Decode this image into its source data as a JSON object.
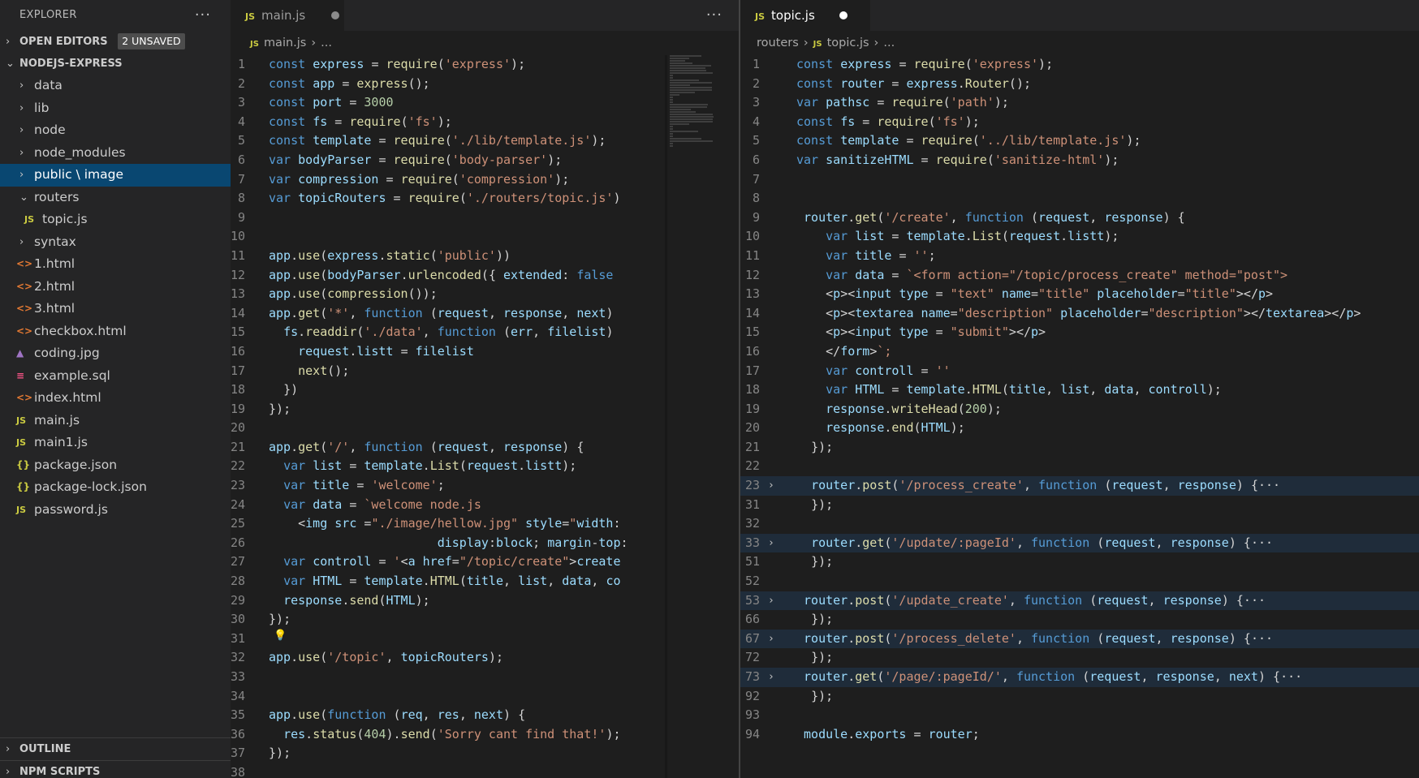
{
  "sidebar": {
    "title": "EXPLORER",
    "more": "···",
    "open_editors": {
      "label": "OPEN EDITORS",
      "badge": "2 UNSAVED"
    },
    "project": {
      "label": "NODEJS-EXPRESS"
    },
    "items": [
      {
        "label": "data",
        "type": "folder",
        "chev": "›"
      },
      {
        "label": "lib",
        "type": "folder",
        "chev": "›"
      },
      {
        "label": "node",
        "type": "folder",
        "chev": "›"
      },
      {
        "label": "node_modules",
        "type": "folder",
        "chev": "›"
      },
      {
        "label": "public \\ image",
        "type": "folder",
        "chev": "›",
        "selected": true
      },
      {
        "label": "routers",
        "type": "folder",
        "chev": "⌄"
      },
      {
        "label": "topic.js",
        "type": "js",
        "indent": true
      },
      {
        "label": "syntax",
        "type": "folder",
        "chev": "›"
      },
      {
        "label": "1.html",
        "type": "html"
      },
      {
        "label": "2.html",
        "type": "html"
      },
      {
        "label": "3.html",
        "type": "html"
      },
      {
        "label": "checkbox.html",
        "type": "html"
      },
      {
        "label": "coding.jpg",
        "type": "img"
      },
      {
        "label": "example.sql",
        "type": "sql"
      },
      {
        "label": "index.html",
        "type": "html"
      },
      {
        "label": "main.js",
        "type": "js"
      },
      {
        "label": "main1.js",
        "type": "js"
      },
      {
        "label": "package.json",
        "type": "json"
      },
      {
        "label": "package-lock.json",
        "type": "json"
      },
      {
        "label": "password.js",
        "type": "js"
      }
    ],
    "outline": "OUTLINE",
    "npm_scripts": "NPM SCRIPTS"
  },
  "icons": {
    "js": "JS",
    "html": "<>",
    "json": "{}",
    "sql": "≡",
    "img": "▲"
  },
  "left_editor": {
    "tab": "main.js",
    "more": "···",
    "breadcrumb": [
      "main.js",
      "..."
    ],
    "lines": [
      {
        "n": "1",
        "t": "const express = require('express');"
      },
      {
        "n": "2",
        "t": "const app = express();"
      },
      {
        "n": "3",
        "t": "const port = 3000"
      },
      {
        "n": "4",
        "t": "const fs = require('fs');"
      },
      {
        "n": "5",
        "t": "const template = require('./lib/template.js');"
      },
      {
        "n": "6",
        "t": "var bodyParser = require('body-parser');"
      },
      {
        "n": "7",
        "t": "var compression = require('compression');"
      },
      {
        "n": "8",
        "t": "var topicRouters = require('./routers/topic.js')"
      },
      {
        "n": "9",
        "t": ""
      },
      {
        "n": "10",
        "t": ""
      },
      {
        "n": "11",
        "t": "app.use(express.static('public'))"
      },
      {
        "n": "12",
        "t": "app.use(bodyParser.urlencoded({ extended: false"
      },
      {
        "n": "13",
        "t": "app.use(compression());"
      },
      {
        "n": "14",
        "t": "app.get('*', function (request, response, next)"
      },
      {
        "n": "15",
        "t": "  fs.readdir('./data', function (err, filelist)"
      },
      {
        "n": "16",
        "t": "    request.listt = filelist"
      },
      {
        "n": "17",
        "t": "    next();"
      },
      {
        "n": "18",
        "t": "  })"
      },
      {
        "n": "19",
        "t": "});"
      },
      {
        "n": "20",
        "t": ""
      },
      {
        "n": "21",
        "t": "app.get('/', function (request, response) {"
      },
      {
        "n": "22",
        "t": "  var list = template.List(request.listt);"
      },
      {
        "n": "23",
        "t": "  var title = 'welcome';"
      },
      {
        "n": "24",
        "t": "  var data = `welcome node.js"
      },
      {
        "n": "25",
        "t": "    <img src =\"./image/hellow.jpg\" style=\"width:"
      },
      {
        "n": "26",
        "t": "                       display:block; margin-top:"
      },
      {
        "n": "27",
        "t": "  var controll = '<a href=\"/topic/create\">create"
      },
      {
        "n": "28",
        "t": "  var HTML = template.HTML(title, list, data, co"
      },
      {
        "n": "29",
        "t": "  response.send(HTML);"
      },
      {
        "n": "30",
        "t": "});"
      },
      {
        "n": "31",
        "t": ""
      },
      {
        "n": "32",
        "t": "app.use('/topic', topicRouters);"
      },
      {
        "n": "33",
        "t": ""
      },
      {
        "n": "34",
        "t": ""
      },
      {
        "n": "35",
        "t": "app.use(function (req, res, next) {"
      },
      {
        "n": "36",
        "t": "  res.status(404).send('Sorry cant find that!');"
      },
      {
        "n": "37",
        "t": "});"
      },
      {
        "n": "38",
        "t": ""
      }
    ]
  },
  "right_editor": {
    "tab": "topic.js",
    "breadcrumb": [
      "routers",
      "topic.js",
      "..."
    ],
    "lines": [
      {
        "n": "1",
        "t": "const express = require('express');"
      },
      {
        "n": "2",
        "t": "const router = express.Router();"
      },
      {
        "n": "3",
        "t": "var pathsc = require('path');"
      },
      {
        "n": "4",
        "t": "const fs = require('fs');"
      },
      {
        "n": "5",
        "t": "const template = require('../lib/template.js');"
      },
      {
        "n": "6",
        "t": "var sanitizeHTML = require('sanitize-html');"
      },
      {
        "n": "7",
        "t": ""
      },
      {
        "n": "8",
        "t": ""
      },
      {
        "n": "9",
        "t": " router.get('/create', function (request, response) {"
      },
      {
        "n": "10",
        "t": "    var list = template.List(request.listt);"
      },
      {
        "n": "11",
        "t": "    var title = '';"
      },
      {
        "n": "12",
        "t": "    var data = `<form action=\"/topic/process_create\" method=\"post\">"
      },
      {
        "n": "13",
        "t": "    <p><input type = \"text\" name=\"title\" placeholder=\"title\"></p>"
      },
      {
        "n": "14",
        "t": "    <p><textarea name=\"description\" placeholder=\"description\"></textarea></p>"
      },
      {
        "n": "15",
        "t": "    <p><input type = \"submit\"></p>"
      },
      {
        "n": "16",
        "t": "    </form>`;"
      },
      {
        "n": "17",
        "t": "    var controll = ''"
      },
      {
        "n": "18",
        "t": "    var HTML = template.HTML(title, list, data, controll);"
      },
      {
        "n": "19",
        "t": "    response.writeHead(200);"
      },
      {
        "n": "20",
        "t": "    response.end(HTML);"
      },
      {
        "n": "21",
        "t": "  });"
      },
      {
        "n": "22",
        "t": ""
      },
      {
        "n": "23",
        "t": "  router.post('/process_create', function (request, response) {···",
        "fold": true
      },
      {
        "n": "31",
        "t": "  });"
      },
      {
        "n": "32",
        "t": ""
      },
      {
        "n": "33",
        "t": "  router.get('/update/:pageId', function (request, response) {···",
        "fold": true
      },
      {
        "n": "51",
        "t": "  });"
      },
      {
        "n": "52",
        "t": ""
      },
      {
        "n": "53",
        "t": " router.post('/update_create', function (request, response) {···",
        "fold": true
      },
      {
        "n": "66",
        "t": "  });"
      },
      {
        "n": "67",
        "t": " router.post('/process_delete', function (request, response) {···",
        "fold": true
      },
      {
        "n": "72",
        "t": "  });"
      },
      {
        "n": "73",
        "t": " router.get('/page/:pageId/', function (request, response, next) {···",
        "fold": true
      },
      {
        "n": "92",
        "t": "  });"
      },
      {
        "n": "93",
        "t": ""
      },
      {
        "n": "94",
        "t": " module.exports = router;"
      }
    ]
  },
  "colors": {
    "background": "#1e1e1e",
    "sidebar": "#252526",
    "selection": "#094771",
    "keyword": "#569cd6",
    "string": "#ce9178",
    "function": "#dcdcaa",
    "variable": "#9cdcfe"
  }
}
